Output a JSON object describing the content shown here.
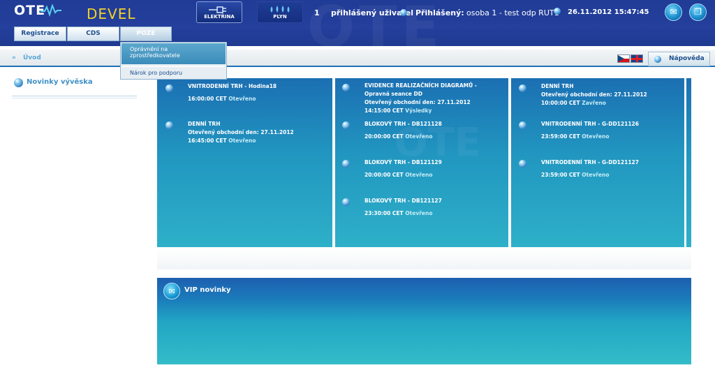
{
  "header": {
    "logo": "OTE",
    "environment": "DEVEL",
    "commodities": [
      {
        "label": "ELEKTŘINA",
        "icon": "plug-icon"
      },
      {
        "label": "PLYN",
        "icon": "gas-flame-icon"
      }
    ],
    "logged_count": "1",
    "logged_users_label": "přihlášený uživatel",
    "logged_in_label": "Přihlášený:",
    "user": "osoba 1 - test odp RUT1",
    "datetime": "26.11.2012 15:47:45",
    "buttons": [
      {
        "icon": "chat-icon"
      },
      {
        "icon": "windows-icon"
      }
    ]
  },
  "menu": {
    "tabs": [
      "Registrace",
      "CDS",
      "POZE"
    ],
    "dropdown": [
      {
        "line1": "Oprávnění na",
        "line2": "zprostředkovatele"
      },
      {
        "line1": "Nárok pro podporu",
        "line2": ""
      }
    ]
  },
  "breadcrumb": {
    "arrow": "»",
    "link": "Úvod",
    "help": "Nápověda",
    "flags": [
      "czech-flag-icon",
      "uk-flag-icon"
    ]
  },
  "sidebar": {
    "title": "Novinky vývěska"
  },
  "panel": {
    "columns": [
      {
        "entries": [
          {
            "title": "VNITRODENNÍ TRH - Hodina18",
            "line2": "",
            "time": "16:00:00 CET",
            "status": "Otevřeno"
          },
          {
            "title": "DENNÍ TRH",
            "line2": "Otevřený obchodní den: 27.11.2012",
            "time": "16:45:00 CET",
            "status": "Otevřeno"
          }
        ]
      },
      {
        "entries": [
          {
            "title": "EVIDENCE REALIZAČNÍCH DIAGRAMŮ -",
            "subtitle": "Opravná seance DD",
            "line2": "Otevřený obchodní den: 27.11.2012",
            "time": "14:15:00 CET",
            "status": "Výsledky"
          },
          {
            "title": "BLOKOVÝ TRH - DB121128",
            "line2": "",
            "time": "20:00:00 CET",
            "status": "Otevřeno"
          },
          {
            "title": "BLOKOVÝ TRH - DB121129",
            "line2": "",
            "time": "20:00:00 CET",
            "status": "Otevřeno"
          },
          {
            "title": "BLOKOVÝ TRH - DB121127",
            "line2": "",
            "time": "23:30:00 CET",
            "status": "Otevřeno"
          }
        ]
      },
      {
        "entries": [
          {
            "title": "DENNÍ TRH",
            "line2": "Otevřený obchodní den: 27.11.2012",
            "time": "10:00:00 CET",
            "status": "Zavřeno"
          },
          {
            "title": "VNITRODENNÍ TRH - G-DD121126",
            "line2": "",
            "time": "23:59:00 CET",
            "status": "Otevřeno"
          },
          {
            "title": "VNITRODENNÍ TRH - G-DD121127",
            "line2": "",
            "time": "23:59:00 CET",
            "status": "Otevřeno"
          }
        ]
      }
    ]
  },
  "vip": {
    "title": "VIP novinky"
  }
}
